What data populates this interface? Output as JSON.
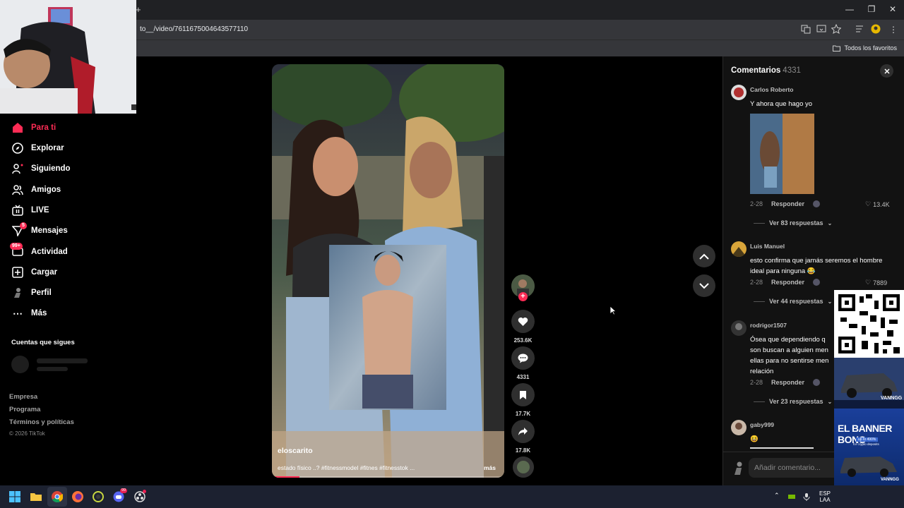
{
  "browser": {
    "url": "to__/video/7611675004643577110",
    "bookmarks_label": "Todos los favoritos"
  },
  "sidebar": {
    "items": [
      {
        "label": "Para ti",
        "icon": "home-icon",
        "active": true
      },
      {
        "label": "Explorar",
        "icon": "compass-icon"
      },
      {
        "label": "Siguiendo",
        "icon": "following-icon"
      },
      {
        "label": "Amigos",
        "icon": "friends-icon"
      },
      {
        "label": "LIVE",
        "icon": "live-icon"
      },
      {
        "label": "Mensajes",
        "icon": "messages-icon",
        "badge": "5"
      },
      {
        "label": "Actividad",
        "icon": "activity-icon",
        "badge": "99+"
      },
      {
        "label": "Cargar",
        "icon": "upload-icon"
      },
      {
        "label": "Perfil",
        "icon": "profile-icon"
      },
      {
        "label": "Más",
        "icon": "more-icon"
      }
    ],
    "following_title": "Cuentas que sigues",
    "footer": [
      "Empresa",
      "Programa",
      "Términos y políticas"
    ],
    "copyright": "© 2026 TikTok"
  },
  "video": {
    "username": "eloscarito",
    "caption": "estado físico ..? #fitnessmodel #fitnes #fitnesstok ...",
    "more_label": "más",
    "progress": 0.12
  },
  "actions": {
    "likes": "253.6K",
    "comments": "4331",
    "saves": "17.7K",
    "shares": "17.8K"
  },
  "comments": {
    "title": "Comentarios",
    "count": "4331",
    "input_placeholder": "Añadir comentario...",
    "reply_label": "Responder",
    "items": [
      {
        "user": "Carlos Roberto",
        "text": "Y ahora que hago yo",
        "date": "2-28",
        "likes": "13.4K",
        "replies": "Ver 83 respuestas"
      },
      {
        "user": "Luis Manuel",
        "text": "esto confirma que jamás seremos el hombre ideal para ninguna 😂",
        "date": "2-28",
        "likes": "7889",
        "replies": "Ver 44 respuestas"
      },
      {
        "user": "rodrigor1507",
        "text": "Ósea que dependiendo q son buscan a alguien men ellas para no sentirse men relación",
        "date": "2-28",
        "likes": "",
        "replies": "Ver 23 respuestas"
      },
      {
        "user": "gaby999",
        "text": "😆",
        "date": "",
        "likes": "",
        "replies": ""
      }
    ]
  },
  "ads": {
    "car_brand": "VANNGG",
    "banner_title": "EL BANNER BONO",
    "banner_sub": "up to 490%",
    "banner_sub2": "for crypto deposits",
    "banner_brand": "VANNGG"
  },
  "taskbar": {
    "lang": "ESP",
    "region": "LAA",
    "chat_badge": "99"
  },
  "colors": {
    "accent": "#fe2c55",
    "background": "#000000",
    "panel": "#121212"
  }
}
